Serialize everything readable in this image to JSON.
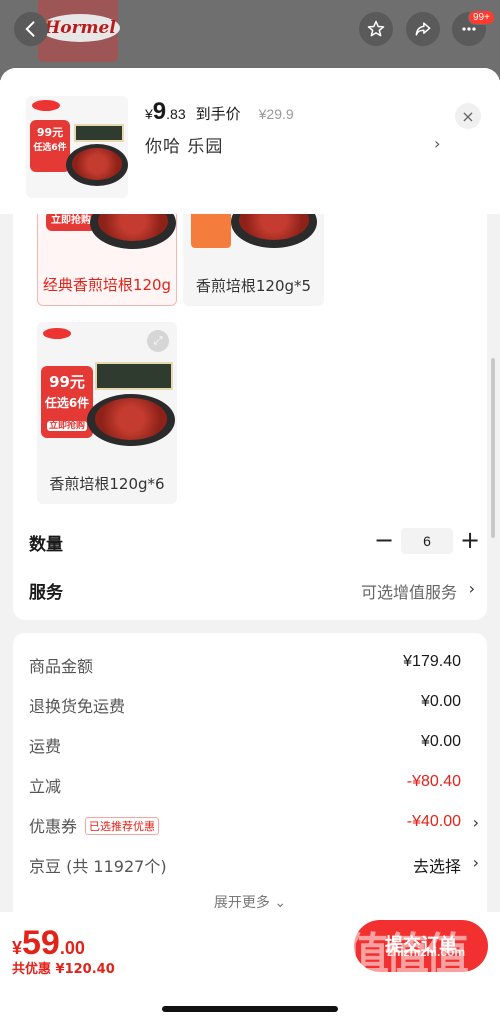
{
  "topbar": {
    "brand": "Hormel",
    "notification_count": "99+"
  },
  "header": {
    "price_symbol": "¥",
    "price_int": "9",
    "price_dec": ".83",
    "price_label": "到手价",
    "original_price": "¥29.9",
    "selected_spec": "你哈  乐园",
    "arrow": "›",
    "close": "×"
  },
  "product_image": {
    "promo_text": "99元",
    "promo_sub": "任选6件",
    "promo_btn": "立即抢购"
  },
  "options": [
    {
      "label": "经典香煎培根120g",
      "selected": true
    },
    {
      "label": "香煎培根120g*5",
      "selected": false
    },
    {
      "label": "香煎培根120g*6",
      "selected": false
    }
  ],
  "quantity": {
    "label": "数量",
    "minus": "−",
    "value": "6",
    "plus": "+"
  },
  "service": {
    "label": "服务",
    "value": "可选增值服务",
    "arrow": "›"
  },
  "fees": {
    "goods_amount": {
      "label": "商品金额",
      "value": "¥179.40"
    },
    "return_shipping": {
      "label": "退换货免运费",
      "value": "¥0.00"
    },
    "shipping": {
      "label": "运费",
      "value": "¥0.00"
    },
    "instant_discount": {
      "label": "立减",
      "value": "-¥80.40"
    },
    "coupon": {
      "label": "优惠券",
      "tag": "已选推荐优惠",
      "value": "-¥40.00",
      "arrow": "›"
    },
    "jingdou": {
      "label": "京豆 (共 11927个)",
      "value": "去选择",
      "arrow": "›"
    },
    "expand_more": "展开更多 ⌄"
  },
  "footer": {
    "total_symbol": "¥",
    "total_int": "59",
    "total_dec": ".00",
    "total_saved": "共优惠 ¥120.40",
    "submit_label": "提交订单"
  },
  "watermark": {
    "big": "值值值",
    "url": "zhizhizhi.com"
  },
  "colors": {
    "accent": "#e2231a",
    "submit_bg": "#f23030"
  }
}
